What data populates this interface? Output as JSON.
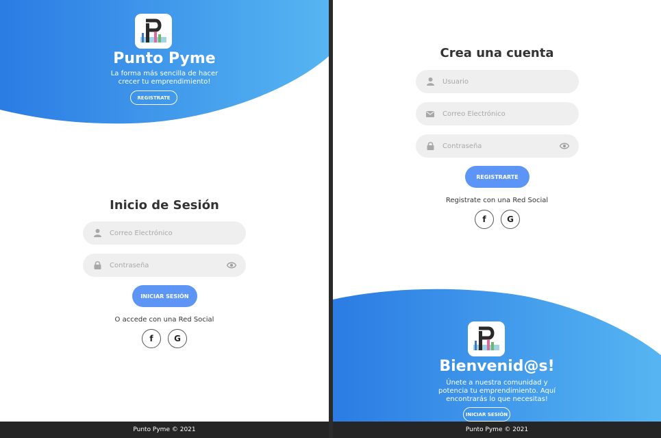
{
  "colors": {
    "accent": "#5c95f5",
    "gradient_start": "#2b7ce3",
    "gradient_end": "#56b5f2",
    "footer": "#252525"
  },
  "login_panel": {
    "brand_title": "Punto Pyme",
    "brand_subtitle_line1": "La forma más sencilla de hacer",
    "brand_subtitle_line2": "crecer tu emprendimiento!",
    "register_button": "REGISTRATE",
    "form_title": "Inicio de Sesión",
    "email_placeholder": "Correo Electrónico",
    "password_placeholder": "Contraseña",
    "submit_button": "INICIAR SESIÓN",
    "social_text": "O accede con una Red Social",
    "social_facebook": "f",
    "social_google": "G",
    "footer": "Punto Pyme © 2021"
  },
  "register_panel": {
    "form_title": "Crea una cuenta",
    "username_placeholder": "Usuario",
    "email_placeholder": "Correo Electrónico",
    "password_placeholder": "Contraseña",
    "submit_button": "REGISTRARTE",
    "social_text": "Registrate con una Red Social",
    "social_facebook": "f",
    "social_google": "G",
    "welcome_title": "Bienvenid@s!",
    "welcome_line1": "Únete a nuestra comunidad y",
    "welcome_line2": "potencia tu emprendimiento. Aquí",
    "welcome_line3": "encontrarás lo que necesitas!",
    "login_button": "INICIAR SESIÓN",
    "footer": "Punto Pyme © 2021"
  },
  "icons": [
    "logo-icon",
    "user-icon",
    "lock-icon",
    "eye-icon",
    "envelope-icon",
    "facebook-icon",
    "google-icon"
  ]
}
